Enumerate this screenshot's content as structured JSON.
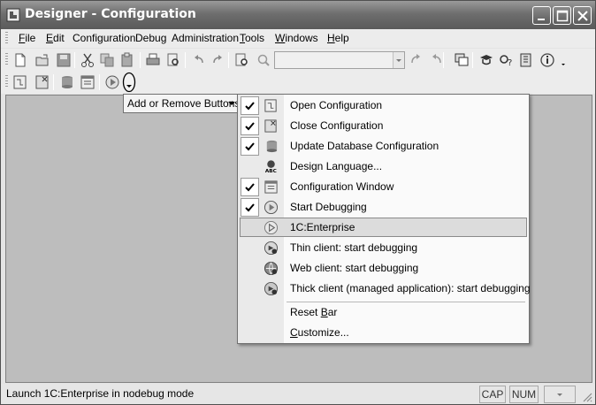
{
  "window": {
    "title": "Designer - Configuration"
  },
  "menubar": {
    "items": [
      {
        "pre": "",
        "u": "F",
        "post": "ile"
      },
      {
        "pre": "",
        "u": "E",
        "post": "dit"
      },
      {
        "pre": "Configuration",
        "u": "",
        "post": ""
      },
      {
        "pre": "Debug",
        "u": "",
        "post": ""
      },
      {
        "pre": "Administration",
        "u": "",
        "post": ""
      },
      {
        "pre": "",
        "u": "T",
        "post": "ools"
      },
      {
        "pre": "",
        "u": "W",
        "post": "indows"
      },
      {
        "pre": "",
        "u": "H",
        "post": "elp"
      }
    ]
  },
  "toolbar": {
    "search_value": ""
  },
  "flyout": {
    "label": "Add or Remove Buttons"
  },
  "menu": {
    "items": [
      {
        "label": "Open Configuration",
        "checked": true,
        "icon": "open-configuration-icon"
      },
      {
        "label": "Close Configuration",
        "checked": true,
        "icon": "close-configuration-icon"
      },
      {
        "label": "Update Database Configuration",
        "checked": true,
        "icon": "update-database-icon"
      },
      {
        "label": "Design Language...",
        "checked": false,
        "icon": "design-language-icon"
      },
      {
        "label": "Configuration Window",
        "checked": true,
        "icon": "configuration-window-icon"
      },
      {
        "label": "Start Debugging",
        "checked": true,
        "icon": "start-debugging-icon"
      },
      {
        "label": "1C:Enterprise",
        "checked": false,
        "icon": "enterprise-run-icon",
        "highlighted": true
      },
      {
        "label": "Thin client: start debugging",
        "checked": false,
        "icon": "thin-client-icon"
      },
      {
        "label": "Web client: start debugging",
        "checked": false,
        "icon": "web-client-icon"
      },
      {
        "label": "Thick client (managed application): start debugging",
        "checked": false,
        "icon": "thick-client-icon"
      }
    ],
    "reset": {
      "pre": "Reset ",
      "u": "B",
      "post": "ar"
    },
    "customize": {
      "pre": "",
      "u": "C",
      "post": "ustomize..."
    }
  },
  "statusbar": {
    "text": "Launch 1C:Enterprise in nodebug mode",
    "cap": "CAP",
    "num": "NUM"
  }
}
